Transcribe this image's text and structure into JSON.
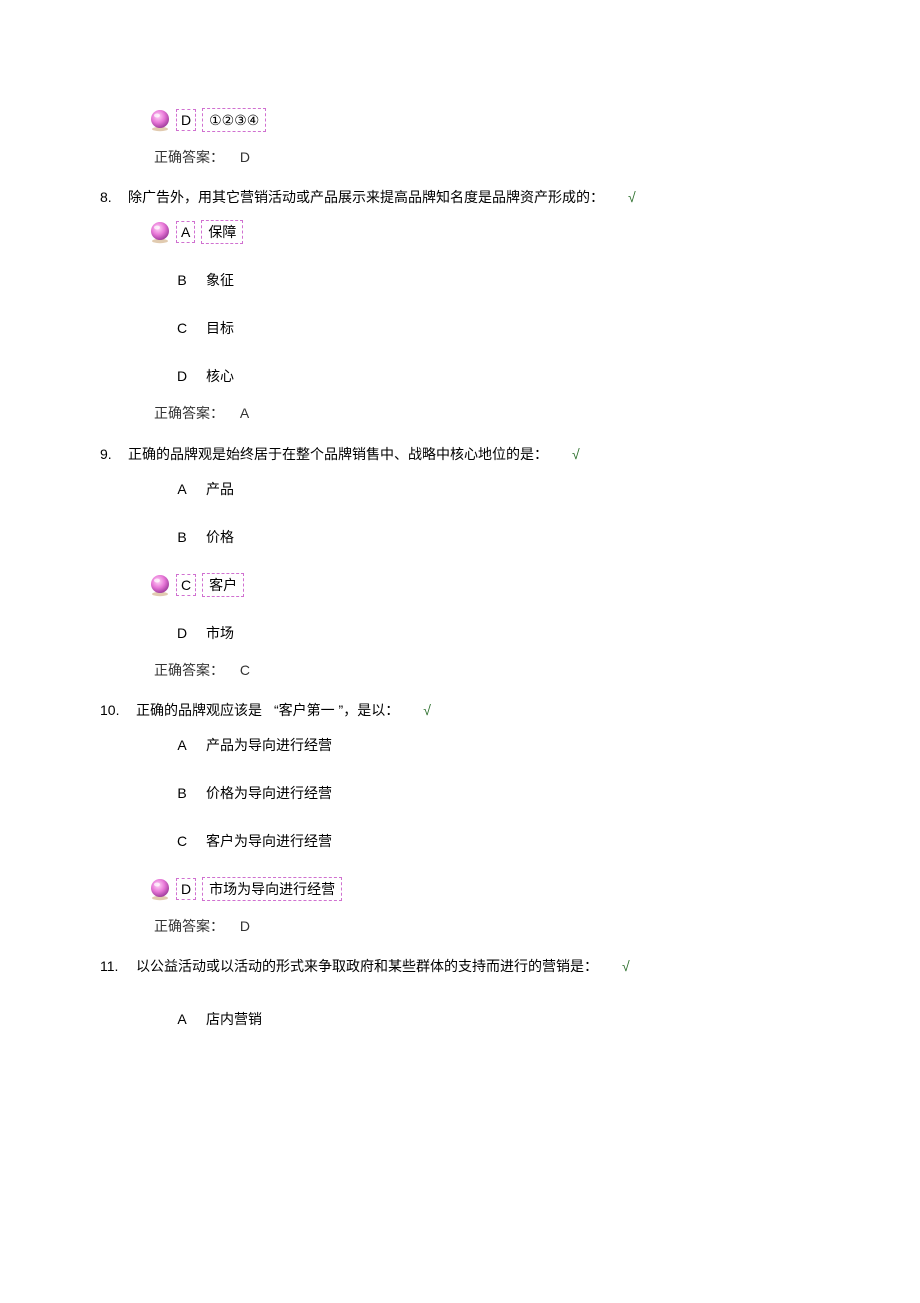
{
  "q7_trailing": {
    "selected_letter": "D",
    "selected_text": "①②③④",
    "correct_label": "正确答案：",
    "correct_value": "D"
  },
  "q8": {
    "number": "8.",
    "text": "除广告外，用其它营销活动或产品展示来提高品牌知名度是品牌资产形成的：",
    "check": "√",
    "options": [
      {
        "letter": "A",
        "text": "保障",
        "selected": true
      },
      {
        "letter": "B",
        "text": "象征",
        "selected": false
      },
      {
        "letter": "C",
        "text": "目标",
        "selected": false
      },
      {
        "letter": "D",
        "text": "核心",
        "selected": false
      }
    ],
    "correct_label": "正确答案：",
    "correct_value": "A"
  },
  "q9": {
    "number": "9.",
    "text": "正确的品牌观是始终居于在整个品牌销售中、战略中核心地位的是：",
    "check": "√",
    "options": [
      {
        "letter": "A",
        "text": "产品",
        "selected": false
      },
      {
        "letter": "B",
        "text": "价格",
        "selected": false
      },
      {
        "letter": "C",
        "text": "客户",
        "selected": true
      },
      {
        "letter": "D",
        "text": "市场",
        "selected": false
      }
    ],
    "correct_label": "正确答案：",
    "correct_value": "C"
  },
  "q10": {
    "number": "10.",
    "text_pre": "正确的品牌观应该是",
    "text_quote": "“客户第一 ”，是以：",
    "check": "√",
    "options": [
      {
        "letter": "A",
        "text": "产品为导向进行经营",
        "selected": false
      },
      {
        "letter": "B",
        "text": "价格为导向进行经营",
        "selected": false
      },
      {
        "letter": "C",
        "text": "客户为导向进行经营",
        "selected": false
      },
      {
        "letter": "D",
        "text": "市场为导向进行经营",
        "selected": true
      }
    ],
    "correct_label": "正确答案：",
    "correct_value": "D"
  },
  "q11": {
    "number": "11.",
    "text": "以公益活动或以活动的形式来争取政府和某些群体的支持而进行的营销是：",
    "check": "√",
    "options": [
      {
        "letter": "A",
        "text": "店内营销",
        "selected": false
      }
    ]
  }
}
